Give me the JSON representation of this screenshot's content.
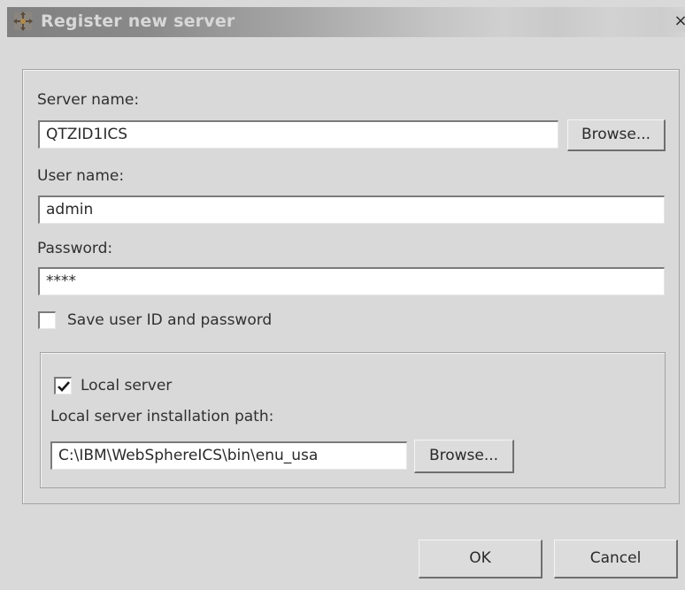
{
  "window": {
    "title": "Register new server",
    "close_glyph": "×"
  },
  "form": {
    "server_name_label": "Server name:",
    "server_name_value": "QTZID1ICS",
    "server_browse_label": "Browse...",
    "user_name_label": "User name:",
    "user_name_value": "admin",
    "password_label": "Password:",
    "password_value": "****",
    "save_credentials_label": "Save user ID and password",
    "save_credentials_checked": false
  },
  "local_group": {
    "local_server_label": "Local server",
    "local_server_checked": true,
    "install_path_label": "Local server installation path:",
    "install_path_value": "C:\\IBM\\WebSphereICS\\bin\\enu_usa",
    "path_browse_label": "Browse..."
  },
  "footer": {
    "ok_label": "OK",
    "cancel_label": "Cancel"
  },
  "icons": {
    "app_icon": "move-arrows-icon",
    "close_icon": "close-icon",
    "check_icon": "checkmark-icon"
  }
}
